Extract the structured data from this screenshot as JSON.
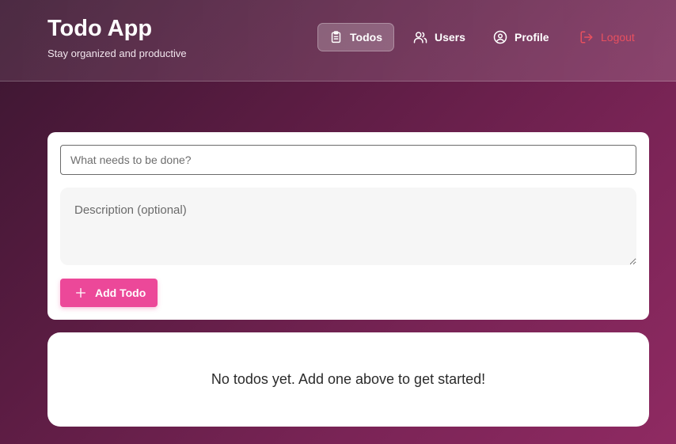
{
  "header": {
    "title": "Todo App",
    "subtitle": "Stay organized and productive"
  },
  "nav": {
    "items": [
      {
        "label": "Todos",
        "icon": "clipboard-icon",
        "active": true
      },
      {
        "label": "Users",
        "icon": "users-icon",
        "active": false
      },
      {
        "label": "Profile",
        "icon": "user-circle-icon",
        "active": false
      },
      {
        "label": "Logout",
        "icon": "logout-icon",
        "active": false
      }
    ]
  },
  "form": {
    "title_placeholder": "What needs to be done?",
    "title_value": "",
    "description_placeholder": "Description (optional)",
    "description_value": "",
    "add_label": "Add Todo"
  },
  "empty_state": {
    "message": "No todos yet. Add one above to get started!"
  },
  "colors": {
    "accent": "#ec4899",
    "logout": "#e8505f",
    "background_start": "#3a1630",
    "background_end": "#8f2a62"
  }
}
